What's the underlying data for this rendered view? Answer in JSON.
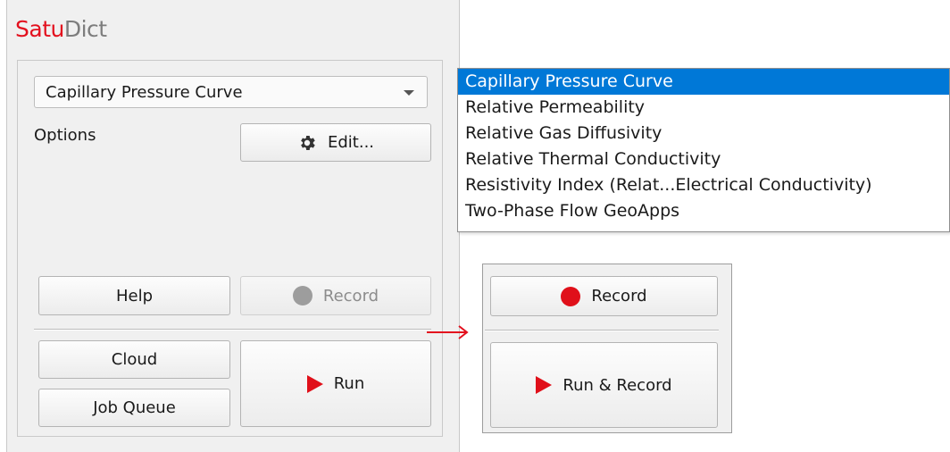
{
  "app": {
    "brand": "Satu",
    "title_rest": "Dict"
  },
  "selector": {
    "value": "Capillary Pressure Curve"
  },
  "options": {
    "label": "Options",
    "edit_label": "Edit..."
  },
  "buttons": {
    "help": "Help",
    "record": "Record",
    "cloud": "Cloud",
    "job_queue": "Job Queue",
    "run": "Run"
  },
  "dropdown": {
    "items": [
      "Capillary Pressure Curve",
      "Relative Permeability",
      "Relative Gas Diffusivity",
      "Relative Thermal Conductivity",
      "Resistivity Index (Relat...Electrical Conductivity)",
      "Two-Phase Flow GeoApps"
    ],
    "selected_index": 0
  },
  "panel2": {
    "record": "Record",
    "run_record": "Run & Record"
  },
  "colors": {
    "accent_red": "#e3101e",
    "selection_blue": "#0078d7",
    "disabled_grey": "#8c8c8c"
  },
  "icons": [
    "gear-icon",
    "record-dot-icon",
    "play-icon",
    "chevron-down-icon",
    "arrow-right-icon"
  ]
}
